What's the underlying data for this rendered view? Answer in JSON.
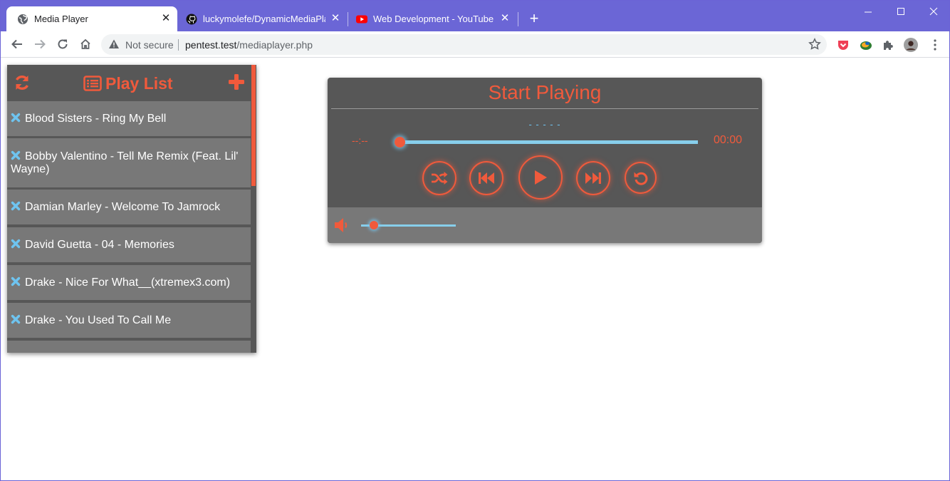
{
  "browser": {
    "tabs": [
      {
        "title": "Media Player",
        "favicon": "globe-icon",
        "active": true
      },
      {
        "title": "luckymolefe/DynamicMediaPlayer",
        "favicon": "github-icon",
        "active": false
      },
      {
        "title": "Web Development - YouTube",
        "favicon": "youtube-icon",
        "active": false
      }
    ],
    "address_bar": {
      "security": "Not secure",
      "host": "pentest.test",
      "path": "/mediaplayer.php"
    }
  },
  "playlist": {
    "title": "Play List",
    "items": [
      "Blood Sisters - Ring My Bell",
      "Bobby Valentino - Tell Me Remix (Feat. Lil' Wayne)",
      "Damian Marley - Welcome To Jamrock",
      "David Guetta - 04 - Memories",
      "Drake - Nice For What__(xtremex3.com)",
      "Drake - You Used To Call Me"
    ]
  },
  "player": {
    "heading": "Start Playing",
    "track_name": "- - - - -",
    "current_time": "--:--",
    "total_time": "00:00",
    "seek_progress": 0,
    "volume_level": 0.1
  },
  "colors": {
    "accent": "#f05a3c",
    "track": "#87ceeb",
    "panel": "#575757",
    "item": "#787878",
    "titlebar": "#6b66d6"
  }
}
